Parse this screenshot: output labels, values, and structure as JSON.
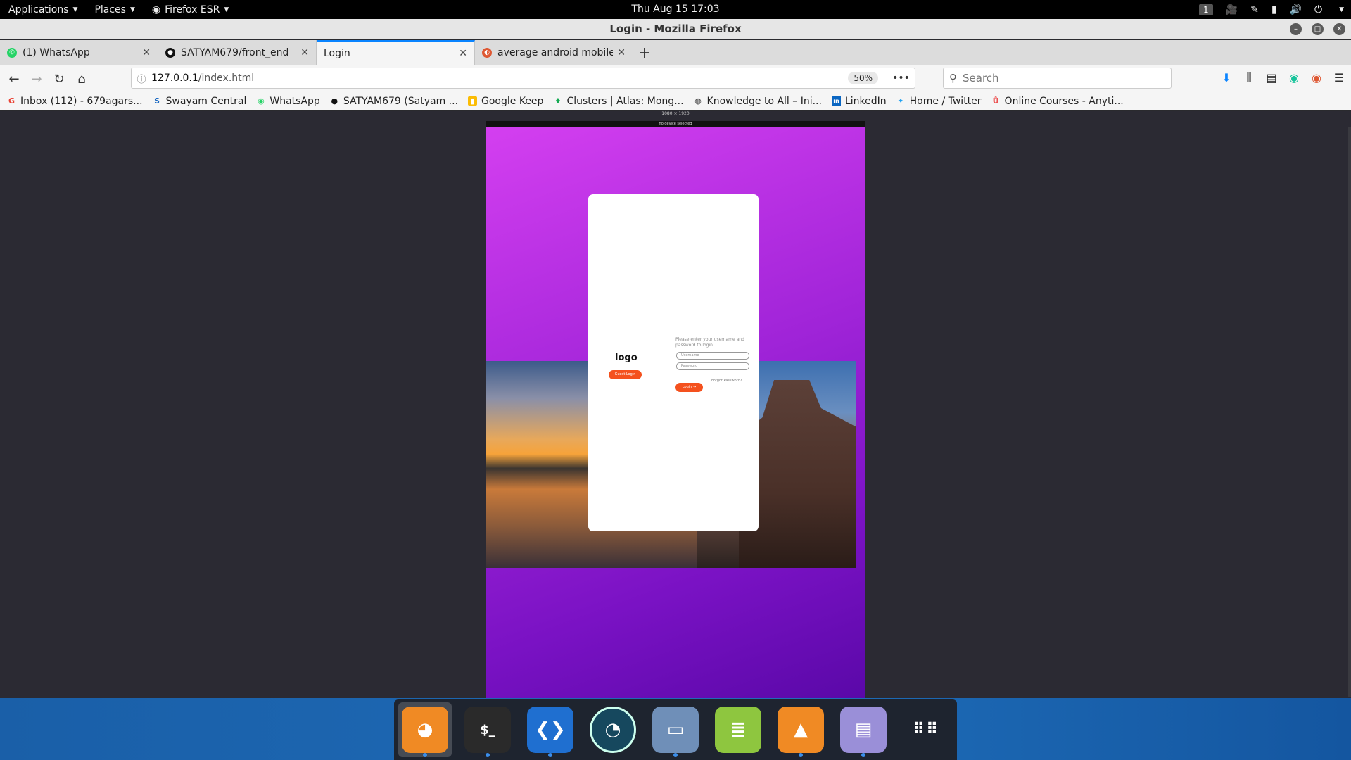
{
  "topbar": {
    "applications": "Applications",
    "places": "Places",
    "browser_menu": "Firefox ESR",
    "clock": "Thu Aug 15  17:03",
    "workspace": "1"
  },
  "window": {
    "title": "Login - Mozilla Firefox"
  },
  "tabs": [
    {
      "label": "(1) WhatsApp",
      "icon": "whatsapp-icon",
      "color": "#25d366"
    },
    {
      "label": "SATYAM679/front_end",
      "icon": "github-icon",
      "color": "#111111"
    },
    {
      "label": "Login",
      "icon": "",
      "color": "",
      "active": true
    },
    {
      "label": "average android mobile",
      "icon": "duckduckgo-icon",
      "color": "#de5833"
    }
  ],
  "navbar": {
    "url_host": "127.0.0.1",
    "url_path": "/index.html",
    "zoom": "50%",
    "search_placeholder": "Search"
  },
  "bookmarks": [
    {
      "label": "Inbox (112) - 679agars...",
      "icon": "google-icon"
    },
    {
      "label": "Swayam Central",
      "icon": "swayam-icon"
    },
    {
      "label": "WhatsApp",
      "icon": "whatsapp-icon"
    },
    {
      "label": "SATYAM679 (Satyam ...",
      "icon": "github-icon"
    },
    {
      "label": "Google Keep",
      "icon": "keep-icon"
    },
    {
      "label": "Clusters | Atlas: Mong...",
      "icon": "mongodb-icon"
    },
    {
      "label": "Knowledge to All – Ini...",
      "icon": "globe-icon"
    },
    {
      "label": "LinkedIn",
      "icon": "linkedin-icon"
    },
    {
      "label": "Home / Twitter",
      "icon": "twitter-icon"
    },
    {
      "label": "Online Courses - Anyti...",
      "icon": "udemy-icon"
    }
  ],
  "rdm": {
    "dimensions": "1080 × 1920",
    "device": "no device selected"
  },
  "login_page": {
    "logo": "logo",
    "guest_button": "Guest Login",
    "prompt": "Please enter your username and password to login",
    "username_placeholder": "Username",
    "password_placeholder": "Password",
    "forgot": "Forgot Password?",
    "login_button": "Login →"
  },
  "dock": [
    {
      "name": "firefox",
      "icon": "firefox-icon",
      "bg": "#f08a24",
      "active": true,
      "running": true
    },
    {
      "name": "terminal",
      "icon": "terminal-icon",
      "bg": "#2a2a2a",
      "running": true
    },
    {
      "name": "vscode",
      "icon": "vscode-icon",
      "bg": "#1f6fd0",
      "running": true
    },
    {
      "name": "stacer",
      "icon": "stacer-icon",
      "bg": "#16485e",
      "running": false
    },
    {
      "name": "files",
      "icon": "folder-icon",
      "bg": "#6f8fb8",
      "running": true
    },
    {
      "name": "notes",
      "icon": "notes-icon",
      "bg": "#8ec63f",
      "running": false
    },
    {
      "name": "vlc",
      "icon": "vlc-icon",
      "bg": "#f08a24",
      "running": true
    },
    {
      "name": "text-editor",
      "icon": "document-icon",
      "bg": "#9a8fd8",
      "running": true
    },
    {
      "name": "show-apps",
      "icon": "app-grid-icon",
      "bg": "transparent",
      "running": false
    }
  ]
}
